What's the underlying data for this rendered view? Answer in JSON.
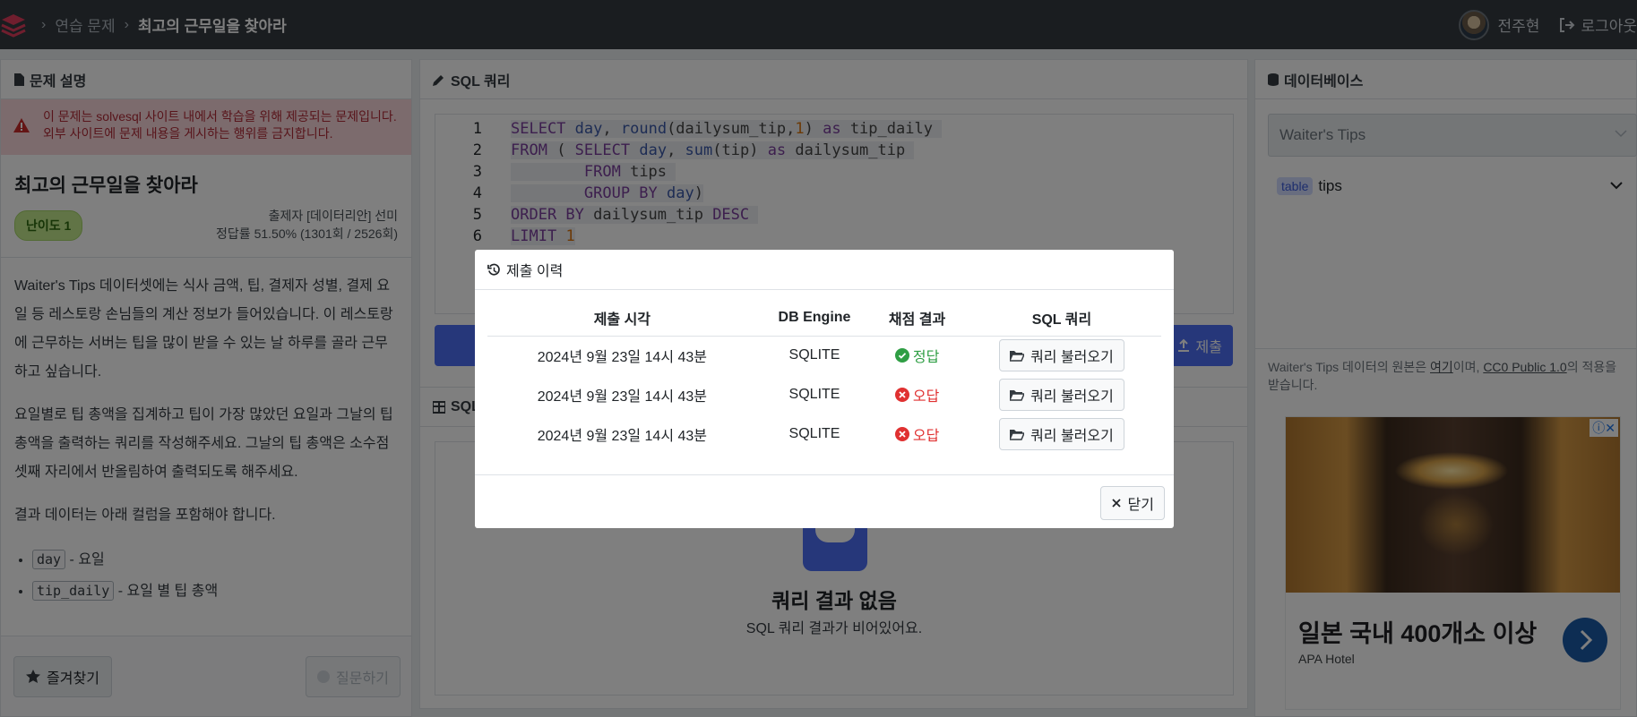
{
  "topbar": {
    "breadcrumb_section": "연습 문제",
    "breadcrumb_current": "최고의 근무일을 찾아라",
    "user_name": "전주현",
    "logout_label": "로그아웃"
  },
  "problem_panel": {
    "header": "문제 설명",
    "alert": "이 문제는 solvesql 사이트 내에서 학습을 위해 제공되는 문제입니다. 외부 사이트에 문제 내용을 게시하는 행위를 금지합니다.",
    "title": "최고의 근무일을 찾아라",
    "level": "난이도 1",
    "author": "출제자 [데이터리안] 선미",
    "accuracy": "정답률 51.50% (1301회 / 2526회)",
    "desc_p1": "Waiter's Tips 데이터셋에는 식사 금액, 팁, 결제자 성별, 결제 요일 등 레스토랑 손님들의 계산 정보가 들어있습니다. 이 레스토랑에 근무하는 서버는 팁을 많이 받을 수 있는 날 하루를 골라 근무하고 싶습니다.",
    "desc_p2": "요일별로 팁 총액을 집계하고 팁이 가장 많았던 요일과 그날의 팁 총액을 출력하는 쿼리를 작성해주세요. 그날의 팁 총액은 소수점 셋째 자리에서 반올림하여 출력되도록 해주세요.",
    "desc_p3": "결과 데이터는 아래 컬럼을 포함해야 합니다.",
    "columns": [
      {
        "name": "day",
        "desc": "- 요일"
      },
      {
        "name": "tip_daily",
        "desc": "- 요일 별 팁 총액"
      }
    ],
    "favorite_label": "즐겨찾기",
    "ask_label": "질문하기"
  },
  "sql_panel": {
    "header": "SQL 쿼리",
    "line_numbers": [
      "1",
      "2",
      "3",
      "4",
      "5",
      "6"
    ],
    "submit_label": "제출"
  },
  "result_panel": {
    "header": "SQL",
    "empty_title": "쿼리 결과 없음",
    "empty_subtitle": "SQL 쿼리 결과가 비어있어요."
  },
  "db_panel": {
    "header": "데이터베이스",
    "selected_db": "Waiter's Tips",
    "table_badge": "table",
    "table_name": "tips",
    "source_note_pre": "Waiter's Tips 데이터의 원본은 ",
    "source_link": "여기",
    "source_mid": "이며, ",
    "license_link": "CC0 Public 1.0",
    "source_post": "의 적용을 받습니다."
  },
  "ad": {
    "title": "일본 국내 400개소 이상",
    "brand": "APA Hotel"
  },
  "modal": {
    "title": "제출 이력",
    "columns": [
      "제출 시각",
      "DB Engine",
      "채점 결과",
      "SQL 쿼리"
    ],
    "rows": [
      {
        "time": "2024년 9월 23일 14시 43분",
        "engine": "SQLITE",
        "result": "정답",
        "action": "쿼리 불러오기"
      },
      {
        "time": "2024년 9월 23일 14시 43분",
        "engine": "SQLITE",
        "result": "오답",
        "action": "쿼리 불러오기"
      },
      {
        "time": "2024년 9월 23일 14시 43분",
        "engine": "SQLITE",
        "result": "오답",
        "action": "쿼리 불러오기"
      }
    ],
    "close_label": "닫기"
  },
  "colors": {
    "accent": "#4c6ef5",
    "success": "#2f9e44",
    "danger": "#e03131"
  }
}
